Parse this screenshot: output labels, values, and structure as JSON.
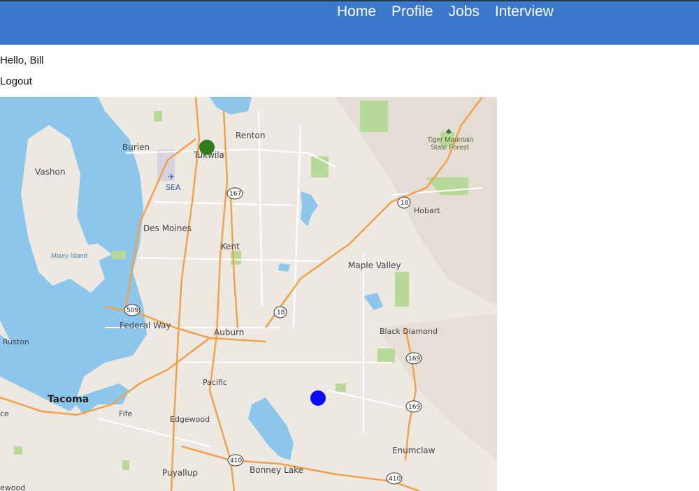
{
  "nav": {
    "items": [
      "Home",
      "Profile",
      "Jobs",
      "Interview"
    ]
  },
  "user": {
    "greeting": "Hello, Bill",
    "logout": "Logout"
  },
  "map": {
    "places": {
      "burien": "Burien",
      "tukwila": "Tukwila",
      "renton": "Renton",
      "vashon": "Vashon",
      "sea": "SEA",
      "des_moines": "Des Moines",
      "maury_island": "Maury Island",
      "kent": "Kent",
      "maple_valley": "Maple Valley",
      "hobart": "Hobart",
      "tiger_mountain": "Tiger Mountain",
      "state_forest": "State Forest",
      "federal_way": "Federal Way",
      "ruston": "Ruston",
      "auburn": "Auburn",
      "black_diamond": "Black Diamond",
      "pacific": "Pacific",
      "tacoma": "Tacoma",
      "fife": "Fife",
      "edgewood": "Edgewood",
      "puyallup": "Puyallup",
      "bonney_lake": "Bonney Lake",
      "enumclaw": "Enumclaw",
      "ce_partial": "ce",
      "ewood_partial": "ewood"
    },
    "shields": {
      "r167": "167",
      "r18a": "18",
      "r18b": "18",
      "r509": "509",
      "r169a": "169",
      "r169b": "169",
      "r410a": "410",
      "r410b": "410"
    },
    "markers": {
      "green_color": "#2e7d1f",
      "blue_color": "#0a0aff"
    },
    "colors": {
      "land": "#ede8e2",
      "water": "#8cc6ea",
      "park": "#b7d99a",
      "highway": "#f0a14a",
      "road": "#ffffff"
    }
  }
}
